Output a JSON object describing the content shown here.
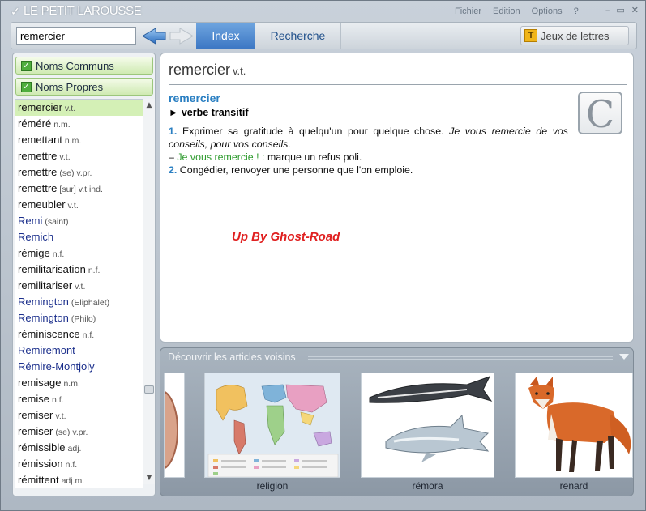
{
  "app": {
    "logo": "LE PETIT LAROUSSE",
    "menu": [
      "Fichier",
      "Edition",
      "Options",
      "?"
    ],
    "window_controls": [
      "–",
      "▭",
      "✕"
    ]
  },
  "toolbar": {
    "search_value": "remercier",
    "tabs": [
      "Index",
      "Recherche"
    ],
    "active_tab": "Index",
    "games_label": "Jeux de lettres",
    "games_icon_letter": "T"
  },
  "sidebar": {
    "categories": [
      "Noms Communs",
      "Noms Propres"
    ],
    "items": [
      {
        "word": "remercier",
        "gram": "v.t.",
        "selected": true,
        "proper": false
      },
      {
        "word": "réméré",
        "gram": "n.m.",
        "selected": false,
        "proper": false
      },
      {
        "word": "remettant",
        "gram": "n.m.",
        "selected": false,
        "proper": false
      },
      {
        "word": "remettre",
        "gram": "v.t.",
        "selected": false,
        "proper": false
      },
      {
        "word": "remettre",
        "gram": "(se) v.pr.",
        "selected": false,
        "proper": false
      },
      {
        "word": "remettre",
        "gram": "[sur] v.t.ind.",
        "selected": false,
        "proper": false
      },
      {
        "word": "remeubler",
        "gram": "v.t.",
        "selected": false,
        "proper": false
      },
      {
        "word": "Remi",
        "gram": "(saint)",
        "selected": false,
        "proper": true
      },
      {
        "word": "Remich",
        "gram": "",
        "selected": false,
        "proper": true
      },
      {
        "word": "rémige",
        "gram": "n.f.",
        "selected": false,
        "proper": false
      },
      {
        "word": "remilitarisation",
        "gram": "n.f.",
        "selected": false,
        "proper": false
      },
      {
        "word": "remilitariser",
        "gram": "v.t.",
        "selected": false,
        "proper": false
      },
      {
        "word": "Remington",
        "gram": "(Eliphalet)",
        "selected": false,
        "proper": true
      },
      {
        "word": "Remington",
        "gram": "(Philo)",
        "selected": false,
        "proper": true
      },
      {
        "word": "réminiscence",
        "gram": "n.f.",
        "selected": false,
        "proper": false
      },
      {
        "word": "Remiremont",
        "gram": "",
        "selected": false,
        "proper": true
      },
      {
        "word": "Rémire-Montjoly",
        "gram": "",
        "selected": false,
        "proper": true
      },
      {
        "word": "remisage",
        "gram": "n.m.",
        "selected": false,
        "proper": false
      },
      {
        "word": "remise",
        "gram": "n.f.",
        "selected": false,
        "proper": false
      },
      {
        "word": "remiser",
        "gram": "v.t.",
        "selected": false,
        "proper": false
      },
      {
        "word": "remiser",
        "gram": "(se) v.pr.",
        "selected": false,
        "proper": false
      },
      {
        "word": "rémissible",
        "gram": "adj.",
        "selected": false,
        "proper": false
      },
      {
        "word": "rémission",
        "gram": "n.f.",
        "selected": false,
        "proper": false
      },
      {
        "word": "rémittent",
        "gram": "adj.m.",
        "selected": false,
        "proper": false
      }
    ]
  },
  "article": {
    "headword": "remercier",
    "headword_gram": "v.t.",
    "entry": "remercier",
    "pos": "verbe transitif",
    "def1_num": "1.",
    "def1_text": "Exprimer sa gratitude à quelqu'un pour quelque chose.",
    "def1_example": "Je vous remercie de vos conseils, pour vos conseils.",
    "phrase_dash": "–",
    "phrase": "Je vous remercie ! :",
    "phrase_meaning": "marque un refus poli.",
    "def2_num": "2.",
    "def2_text": "Congédier, renvoyer une personne que l'on emploie.",
    "letter_icon": "C",
    "watermark": "Up By Ghost-Road"
  },
  "neighbors": {
    "title": "Découvrir les articles voisins",
    "items": [
      "religion",
      "rémora",
      "renard"
    ]
  },
  "colors": {
    "accent_blue": "#3c77c4",
    "selection_green": "#d4f0b6",
    "link_blue": "#2a7fc2",
    "watermark_red": "#e02020"
  }
}
